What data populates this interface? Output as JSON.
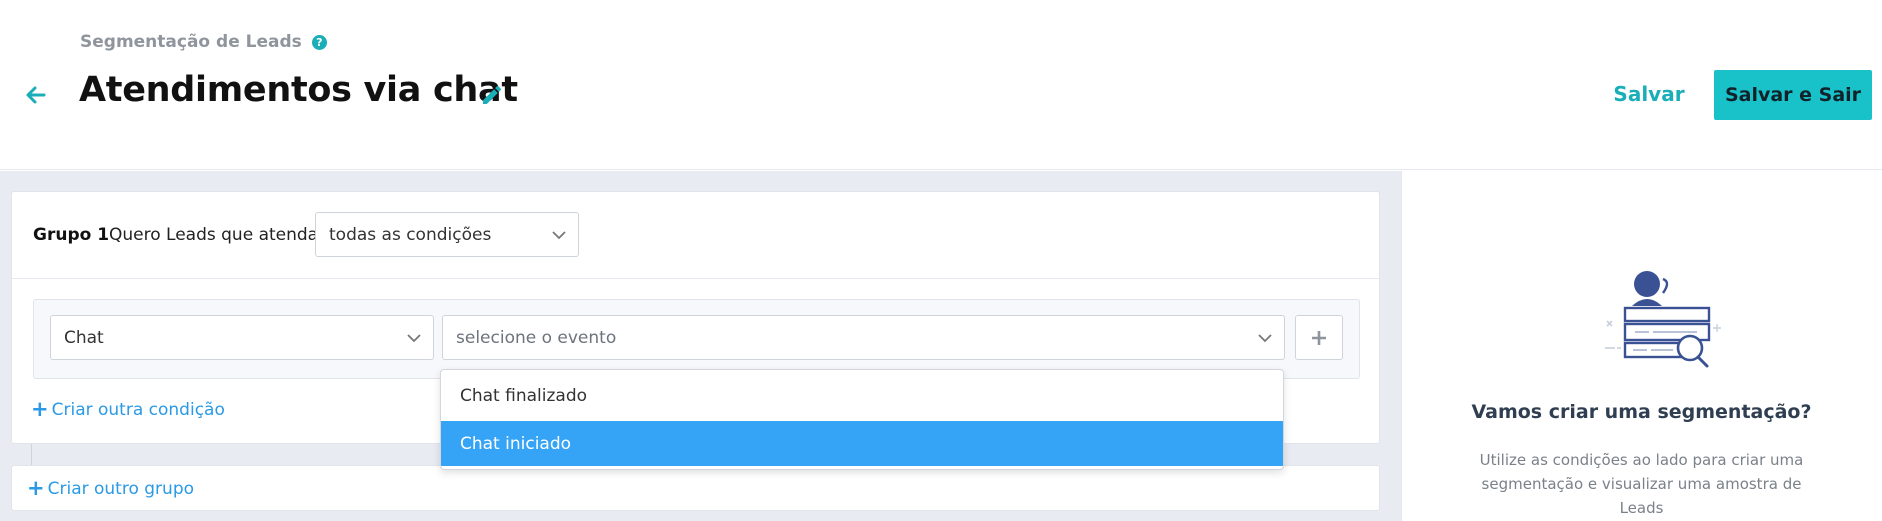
{
  "header": {
    "breadcrumb": "Segmentação de Leads",
    "title": "Atendimentos via chat",
    "save_label": "Salvar",
    "save_exit_label": "Salvar e Sair"
  },
  "group": {
    "label": "Grupo 1",
    "description": "Quero Leads que atendam",
    "match_select_value": "todas as condições",
    "condition": {
      "source_value": "Chat",
      "event_placeholder": "selecione o evento"
    },
    "add_condition_label": "Criar outra condição"
  },
  "add_group_label": "Criar outro grupo",
  "event_dropdown": {
    "options": [
      "Chat finalizado",
      "Chat iniciado"
    ],
    "highlighted": "Chat iniciado"
  },
  "side_panel": {
    "title": "Vamos criar uma segmentação?",
    "description": "Utilize as condições ao lado para criar uma segmentação e visualizar uma amostra de Leads"
  },
  "colors": {
    "accent": "#19c2c9",
    "link": "#2a9ae6",
    "highlight": "#35a4f7",
    "background": "#e8ebf2"
  }
}
